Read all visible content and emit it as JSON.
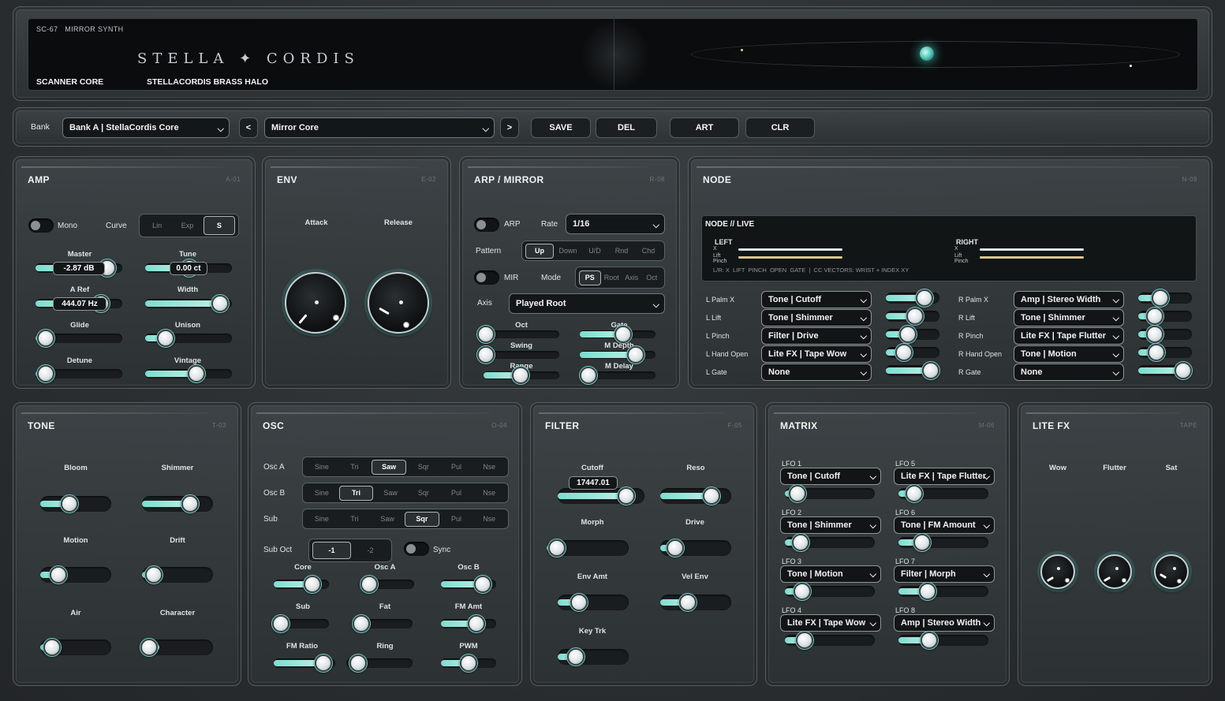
{
  "header": {
    "model": "SC-67",
    "model_name": "MIRROR SYNTH",
    "logo": "STELLA ✦ CORDIS",
    "core": "SCANNER CORE",
    "preset_title": "STELLACORDIS BRASS HALO"
  },
  "toolbar": {
    "bank_label": "Bank",
    "bank_value": "Bank A | StellaCordis Core",
    "prev": "<",
    "next": ">",
    "preset_value": "Mirror Core",
    "save": "SAVE",
    "del": "DEL",
    "art": "ART",
    "clr": "CLR"
  },
  "amp": {
    "title": "AMP",
    "code": "A-01",
    "mono": "Mono",
    "curve": "Curve",
    "curve_options": [
      "Lin",
      "Exp",
      "S"
    ],
    "curve_selected": "S",
    "master": "Master",
    "master_value": "-2.87 dB",
    "tune": "Tune",
    "tune_value": "0.00 ct",
    "aref": "A Ref",
    "aref_value": "444.07 Hz",
    "width": "Width",
    "glide": "Glide",
    "unison": "Unison",
    "detune": "Detune",
    "vintage": "Vintage"
  },
  "env": {
    "title": "ENV",
    "code": "E-02",
    "attack": "Attack",
    "release": "Release"
  },
  "arp": {
    "title": "ARP / MIRROR",
    "code": "R-08",
    "arp": "ARP",
    "rate": "Rate",
    "rate_value": "1/16",
    "pattern": "Pattern",
    "pattern_options": [
      "Up",
      "Down",
      "U/D",
      "Rnd",
      "Chd"
    ],
    "pattern_selected": "Up",
    "mir": "MIR",
    "mode": "Mode",
    "mode_options": [
      "PS",
      "Root",
      "Axis",
      "Oct"
    ],
    "mode_selected": "PS",
    "axis": "Axis",
    "axis_value": "Played Root",
    "oct": "Oct",
    "gate": "Gate",
    "swing": "Swing",
    "mdepth": "M Depth",
    "range": "Range",
    "mdelay": "M Delay"
  },
  "node": {
    "title": "NODE",
    "code": "N-09",
    "live": "NODE // LIVE",
    "left": "LEFT",
    "right": "RIGHT",
    "x": "X",
    "lift": "Lift",
    "pinch": "Pinch",
    "footer": "L/R: X  LIFT  PINCH  OPEN  GATE  |  CC VECTORS: WRIST + INDEX XY",
    "left_rows": [
      {
        "label": "L Palm X",
        "value": "Tone | Cutoff",
        "level": 0.8
      },
      {
        "label": "L Lift",
        "value": "Tone | Shimmer",
        "level": 0.55
      },
      {
        "label": "L Pinch",
        "value": "Filter | Drive",
        "level": 0.35
      },
      {
        "label": "L Hand Open",
        "value": "Lite FX | Tape Wow",
        "level": 0.25
      },
      {
        "label": "L Gate",
        "value": "None",
        "level": 0.95
      }
    ],
    "right_rows": [
      {
        "label": "R Palm X",
        "value": "Amp | Stereo Width",
        "level": 0.35
      },
      {
        "label": "R Lift",
        "value": "Tone | Shimmer",
        "level": 0.2
      },
      {
        "label": "R Pinch",
        "value": "Lite FX | Tape Flutter",
        "level": 0.2
      },
      {
        "label": "R Hand Open",
        "value": "Tone | Motion",
        "level": 0.25
      },
      {
        "label": "R Gate",
        "value": "None",
        "level": 0.95
      }
    ]
  },
  "tone": {
    "title": "TONE",
    "code": "T-03",
    "bloom": "Bloom",
    "shimmer": "Shimmer",
    "motion": "Motion",
    "drift": "Drift",
    "air": "Air",
    "character": "Character"
  },
  "osc": {
    "title": "OSC",
    "code": "O-04",
    "waves": [
      "Sine",
      "Tri",
      "Saw",
      "Sqr",
      "Pul",
      "Nse"
    ],
    "osc_a": "Osc A",
    "osc_a_sel": "Saw",
    "osc_b": "Osc B",
    "osc_b_sel": "Tri",
    "sub": "Sub",
    "sub_sel": "Sqr",
    "sub_oct": "Sub Oct",
    "sub_oct_options": [
      "-1",
      "-2"
    ],
    "sub_oct_sel": "-1",
    "sync": "Sync",
    "core": "Core",
    "osca_lvl": "Osc A",
    "oscb_lvl": "Osc B",
    "sub_lvl": "Sub",
    "fat": "Fat",
    "fm_amt": "FM Amt",
    "fm_ratio": "FM Ratio",
    "ring": "Ring",
    "pwm": "PWM"
  },
  "filter": {
    "title": "FILTER",
    "code": "F-05",
    "cutoff": "Cutoff",
    "cutoff_value": "17447.01",
    "reso": "Reso",
    "morph": "Morph",
    "drive": "Drive",
    "env_amt": "Env Amt",
    "vel_env": "Vel Env",
    "key_trk": "Key Trk"
  },
  "matrix": {
    "title": "MATRIX",
    "code": "M-06",
    "lfos": [
      {
        "label": "LFO 1",
        "value": "Tone | Cutoff"
      },
      {
        "label": "LFO 2",
        "value": "Tone | Shimmer"
      },
      {
        "label": "LFO 3",
        "value": "Tone | Motion"
      },
      {
        "label": "LFO 4",
        "value": "Lite FX | Tape Wow"
      },
      {
        "label": "LFO 5",
        "value": "Lite FX | Tape Flutter"
      },
      {
        "label": "LFO 6",
        "value": "Tone | FM Amount"
      },
      {
        "label": "LFO 7",
        "value": "Filter | Morph"
      },
      {
        "label": "LFO 8",
        "value": "Amp | Stereo Width"
      }
    ]
  },
  "litefx": {
    "title": "LITE FX",
    "code": "TAPE",
    "wow": "Wow",
    "flutter": "Flutter",
    "sat": "Sat"
  },
  "colors": {
    "accent": "#7fdccf",
    "panel": "#3a3f42",
    "background": "#2b2f31"
  }
}
